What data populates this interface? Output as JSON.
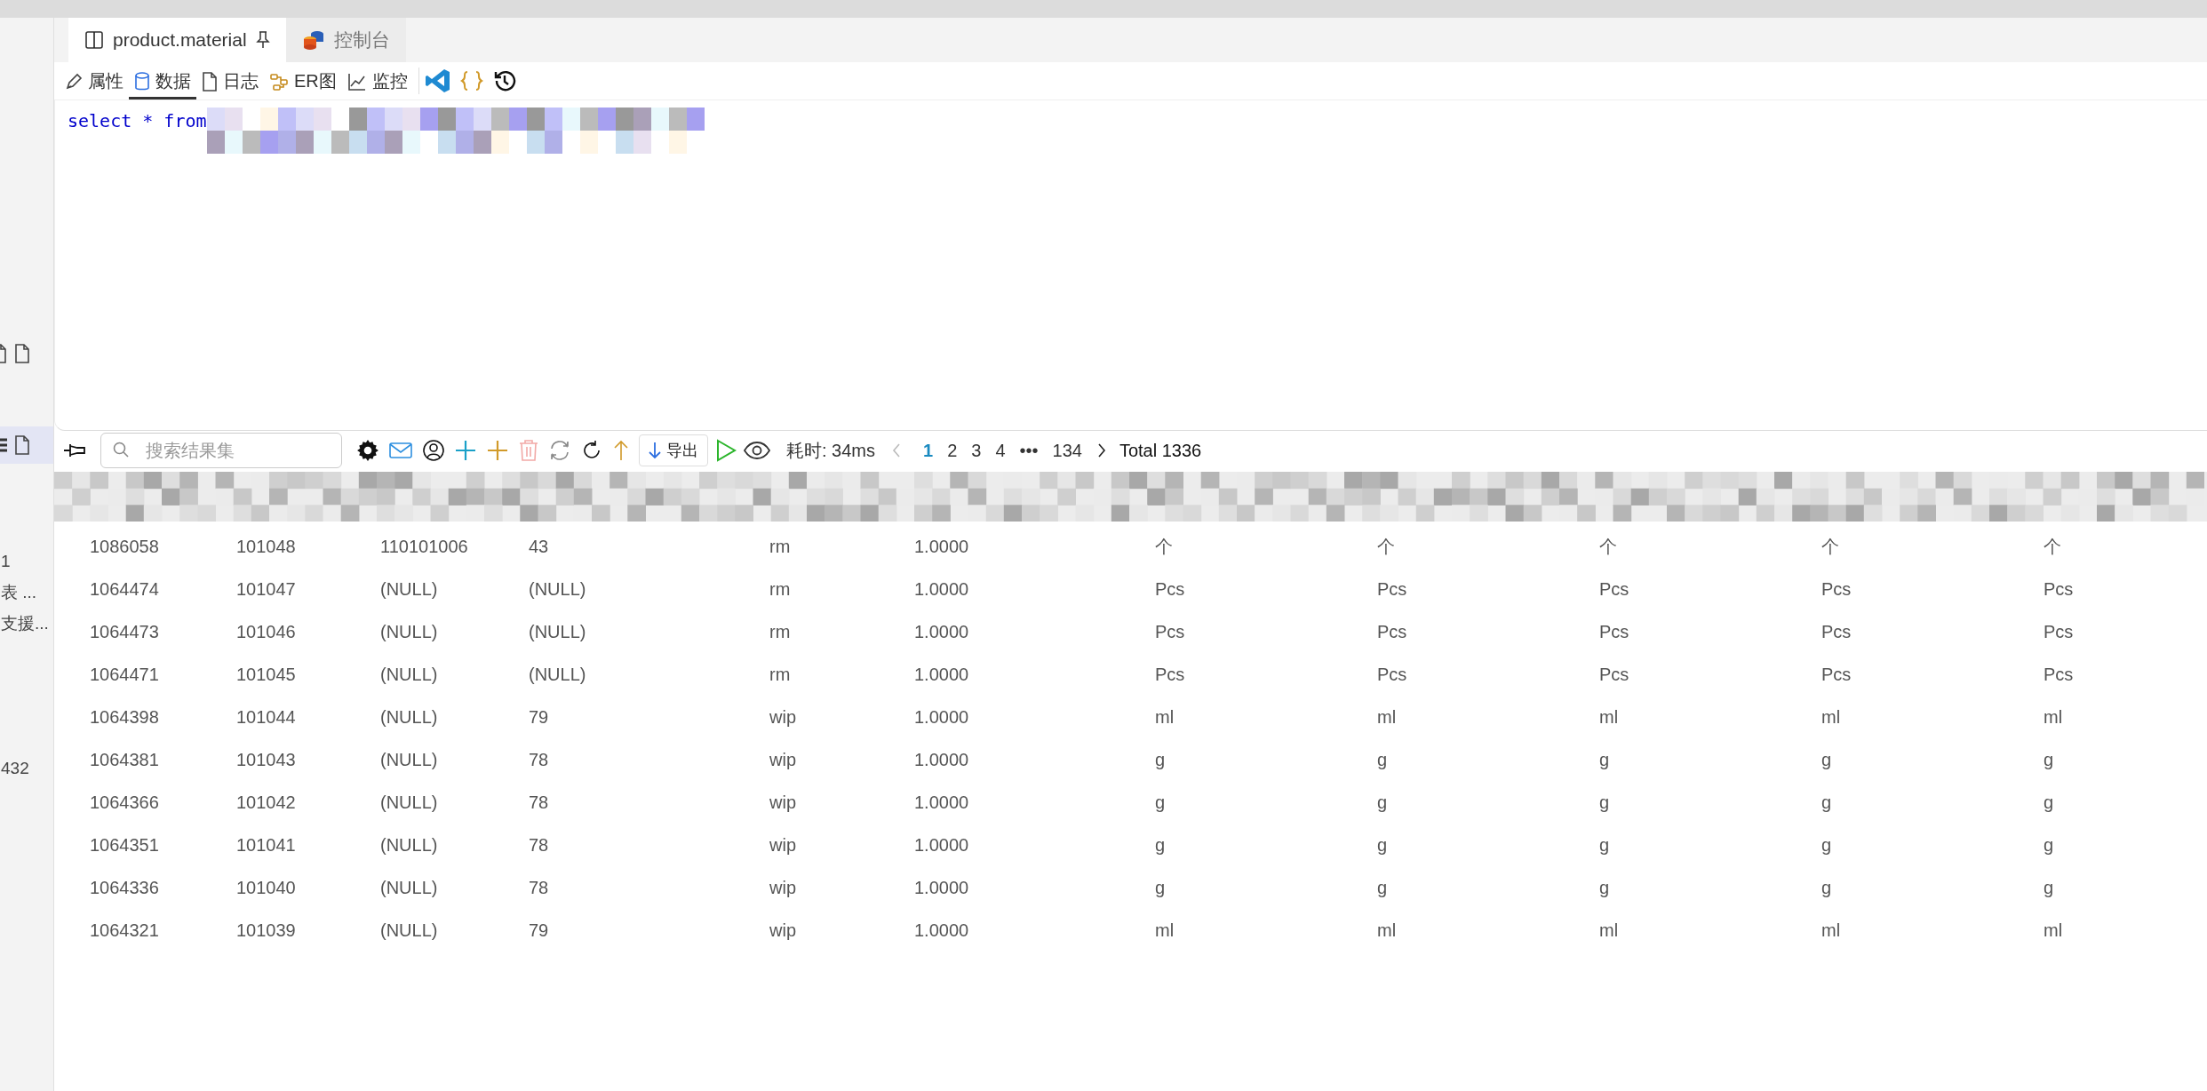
{
  "sidebar": {
    "items": [
      {
        "text": "1"
      },
      {
        "text": "表 ..."
      },
      {
        "text": "支援..."
      },
      {
        "text": "432"
      }
    ]
  },
  "tabs": [
    {
      "label": "product.material",
      "selected": true,
      "kind": "table"
    },
    {
      "label": "控制台",
      "selected": false,
      "kind": "console"
    }
  ],
  "view_tabs": [
    {
      "label": "属性",
      "selected": false,
      "kind": "pencil"
    },
    {
      "label": "数据",
      "selected": true,
      "kind": "database"
    },
    {
      "label": "日志",
      "selected": false,
      "kind": "file"
    },
    {
      "label": "ER图",
      "selected": false,
      "kind": "er"
    },
    {
      "label": "监控",
      "selected": false,
      "kind": "chart"
    }
  ],
  "editor": {
    "query": "select * from"
  },
  "results_toolbar": {
    "search": {
      "placeholder": "搜索结果集"
    },
    "tools": [
      {
        "kind": "gear",
        "disabled": false
      },
      {
        "kind": "mail",
        "disabled": false
      },
      {
        "kind": "user",
        "disabled": false
      },
      {
        "kind": "plus-blue",
        "disabled": false
      },
      {
        "kind": "plus-gold",
        "disabled": false
      },
      {
        "kind": "trash",
        "disabled": true
      },
      {
        "kind": "sync",
        "disabled": false
      },
      {
        "kind": "refresh",
        "disabled": false
      },
      {
        "kind": "up",
        "disabled": false
      }
    ],
    "export_button": "导出",
    "elapsed": "耗时: 34ms",
    "pages": [
      {
        "label": "1",
        "selected": true
      },
      {
        "label": "2",
        "selected": false
      },
      {
        "label": "3",
        "selected": false
      },
      {
        "label": "4",
        "selected": false
      },
      {
        "label": "•••",
        "selected": false
      },
      {
        "label": "134",
        "selected": false
      }
    ],
    "total": "Total 1336"
  },
  "table": {
    "rows": [
      [
        "1086058",
        "101048",
        "110101006",
        "43",
        "rm",
        "1.0000",
        "个",
        "个",
        "个",
        "个",
        "个"
      ],
      [
        "1064474",
        "101047",
        "(NULL)",
        "(NULL)",
        "rm",
        "1.0000",
        "Pcs",
        "Pcs",
        "Pcs",
        "Pcs",
        "Pcs"
      ],
      [
        "1064473",
        "101046",
        "(NULL)",
        "(NULL)",
        "rm",
        "1.0000",
        "Pcs",
        "Pcs",
        "Pcs",
        "Pcs",
        "Pcs"
      ],
      [
        "1064471",
        "101045",
        "(NULL)",
        "(NULL)",
        "rm",
        "1.0000",
        "Pcs",
        "Pcs",
        "Pcs",
        "Pcs",
        "Pcs"
      ],
      [
        "1064398",
        "101044",
        "(NULL)",
        "79",
        "wip",
        "1.0000",
        "ml",
        "ml",
        "ml",
        "ml",
        "ml"
      ],
      [
        "1064381",
        "101043",
        "(NULL)",
        "78",
        "wip",
        "1.0000",
        "g",
        "g",
        "g",
        "g",
        "g"
      ],
      [
        "1064366",
        "101042",
        "(NULL)",
        "78",
        "wip",
        "1.0000",
        "g",
        "g",
        "g",
        "g",
        "g"
      ],
      [
        "1064351",
        "101041",
        "(NULL)",
        "78",
        "wip",
        "1.0000",
        "g",
        "g",
        "g",
        "g",
        "g"
      ],
      [
        "1064336",
        "101040",
        "(NULL)",
        "78",
        "wip",
        "1.0000",
        "g",
        "g",
        "g",
        "g",
        "g"
      ],
      [
        "1064321",
        "101039",
        "(NULL)",
        "79",
        "wip",
        "1.0000",
        "ml",
        "ml",
        "ml",
        "ml",
        "ml"
      ]
    ]
  }
}
